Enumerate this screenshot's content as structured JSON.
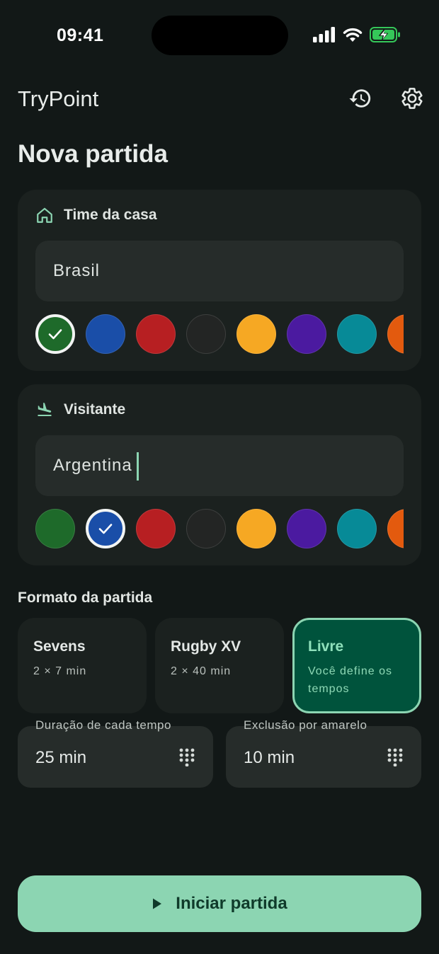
{
  "status": {
    "time": "09:41"
  },
  "app": {
    "title": "TryPoint"
  },
  "page": {
    "title": "Nova partida"
  },
  "home": {
    "label": "Time da casa",
    "value": "Brasil",
    "selected_color": "#1e6a2a"
  },
  "away": {
    "label": "Visitante",
    "value": "Argentina",
    "selected_color": "#1a4ea8"
  },
  "colors": [
    "#1e6a2a",
    "#1a4ea8",
    "#b71f22",
    "#232524",
    "#f6a823",
    "#4b1aa0",
    "#078a97",
    "#e35a0e"
  ],
  "format": {
    "label": "Formato da partida",
    "options": [
      {
        "name": "Sevens",
        "desc": "2 × 7 min",
        "selected": false
      },
      {
        "name": "Rugby XV",
        "desc": "2 × 40 min",
        "selected": false
      },
      {
        "name": "Livre",
        "desc": "Você define os tempos",
        "selected": true
      }
    ]
  },
  "duration": {
    "label": "Duração de cada tempo",
    "value": "25 min"
  },
  "yellow": {
    "label": "Exclusão por amarelo",
    "value": "10 min"
  },
  "start": {
    "label": "Iniciar partida"
  }
}
